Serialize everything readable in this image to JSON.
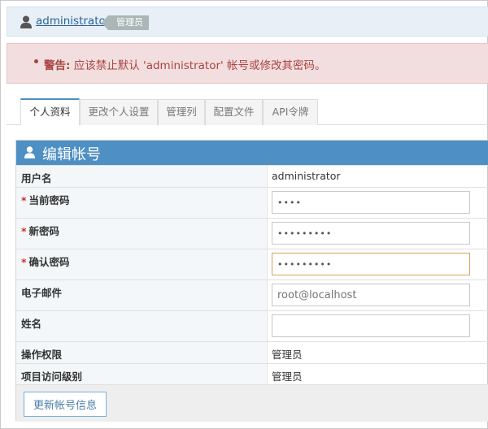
{
  "user": {
    "name": "administrator",
    "role": "管理员"
  },
  "warning": {
    "label": "警告:",
    "message": "应该禁止默认 'administrator' 帐号或修改其密码。"
  },
  "tabs": [
    {
      "label": "个人资料",
      "active": true
    },
    {
      "label": "更改个人设置"
    },
    {
      "label": "管理列"
    },
    {
      "label": "配置文件"
    },
    {
      "label": "API令牌"
    }
  ],
  "form": {
    "title": "编辑帐号",
    "username_label": "用户名",
    "username_value": "administrator",
    "current_password_label": "当前密码",
    "current_password_value": "1234",
    "new_password_label": "新密码",
    "new_password_value": "123456789",
    "confirm_password_label": "确认密码",
    "confirm_password_value": "123456789",
    "email_label": "电子邮件",
    "email_placeholder": "root@localhost",
    "realname_label": "姓名",
    "realname_value": "",
    "access_label": "操作权限",
    "access_value": "管理员",
    "project_access_label": "项目访问级别",
    "project_access_value": "管理员",
    "required_mark": "*",
    "submit_label": "更新帐号信息"
  },
  "colors": {
    "header_blue": "#4e8fc4",
    "link": "#2a6496",
    "warning_bg": "#f2dede",
    "warning_text": "#a94442"
  }
}
